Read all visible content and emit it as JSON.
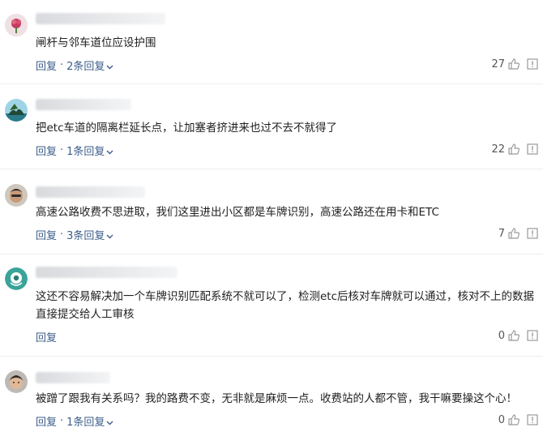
{
  "labels": {
    "reply": "回复"
  },
  "comments": [
    {
      "text": "闸杆与邻车道位应设护围",
      "reply_count": "2条回复",
      "likes": "27"
    },
    {
      "text": "把etc车道的隔离栏延长点，让加塞者挤进来也过不去不就得了",
      "reply_count": "1条回复",
      "likes": "22"
    },
    {
      "text": "高速公路收费不思进取，我们这里进出小区都是车牌识别，高速公路还在用卡和ETC",
      "reply_count": "3条回复",
      "likes": "7"
    },
    {
      "text": "这还不容易解决加一个车牌识别匹配系统不就可以了，检测etc后核对车牌就可以通过，核对不上的数据直接提交给人工审核",
      "reply_count": "",
      "likes": "0"
    },
    {
      "text": "被蹭了跟我有关系吗？我的路费不变，无非就是麻烦一点。收费站的人都不管，我干嘛要操这个心！",
      "reply_count": "1条回复",
      "likes": "0"
    }
  ],
  "colors": {
    "link": "#3d5d8a",
    "divider": "#ededed"
  },
  "icons": [
    "avatar",
    "thumbs-up-icon",
    "report-icon",
    "chevron-down-icon"
  ]
}
